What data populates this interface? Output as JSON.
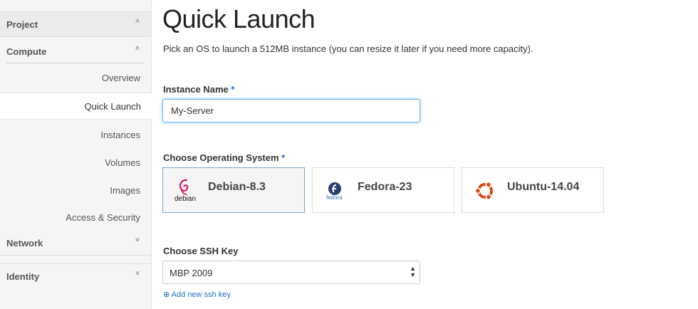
{
  "sidebar": {
    "sections": {
      "project": {
        "label": "Project",
        "chevron": "chevron-up-icon"
      },
      "compute": {
        "label": "Compute",
        "chevron": "chevron-up-icon"
      },
      "network": {
        "label": "Network",
        "chevron": "chevron-down-icon"
      },
      "identity": {
        "label": "Identity",
        "chevron": "chevron-down-icon"
      }
    },
    "items": [
      {
        "label": "Overview",
        "active": false
      },
      {
        "label": "Quick Launch",
        "active": true
      },
      {
        "label": "Instances",
        "active": false
      },
      {
        "label": "Volumes",
        "active": false
      },
      {
        "label": "Images",
        "active": false
      },
      {
        "label": "Access & Security",
        "active": false
      }
    ]
  },
  "main": {
    "title": "Quick Launch",
    "subtitle": "Pick an OS to launch a 512MB instance (you can resize it later if you need more capacity).",
    "instance_name": {
      "label": "Instance Name",
      "required_mark": "*",
      "value": "My-Server"
    },
    "os": {
      "label": "Choose Operating System",
      "required_mark": "*",
      "options": [
        {
          "name": "Debian-8.3",
          "logo_text": "debian",
          "icon": "debian-logo-icon",
          "selected": true
        },
        {
          "name": "Fedora-23",
          "logo_text": "fedora",
          "icon": "fedora-logo-icon",
          "selected": false
        },
        {
          "name": "Ubuntu-14.04",
          "logo_text": "",
          "icon": "ubuntu-logo-icon",
          "selected": false
        }
      ]
    },
    "ssh_key": {
      "label": "Choose SSH Key",
      "selected": "MBP 2009",
      "add_link": "Add new ssh key",
      "add_icon": "plus-circle-icon"
    }
  },
  "colors": {
    "accent": "#1a70c8",
    "focus_border": "#66afe9",
    "ubuntu_orange": "#dd4814",
    "debian_red": "#d70751",
    "fedora_blue": "#294172"
  }
}
